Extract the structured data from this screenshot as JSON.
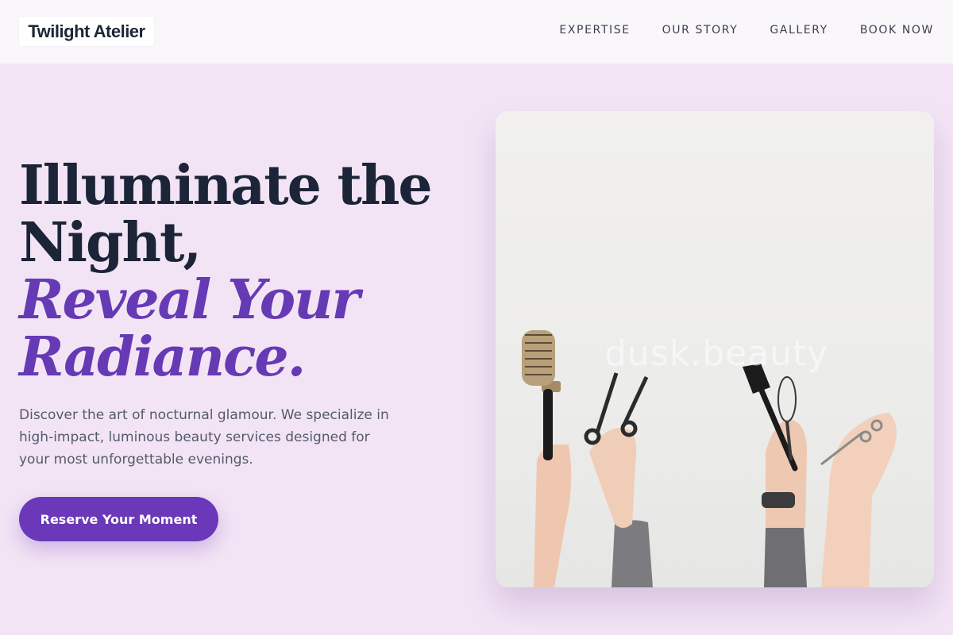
{
  "header": {
    "brand": "Twilight Atelier",
    "nav": [
      {
        "label": "EXPERTISE"
      },
      {
        "label": "OUR STORY"
      },
      {
        "label": "GALLERY"
      },
      {
        "label": "BOOK NOW"
      }
    ]
  },
  "hero": {
    "headline_line1": "Illuminate the",
    "headline_line2": "Night,",
    "headline_accent1": "Reveal Your",
    "headline_accent2": "Radiance.",
    "description": "Discover the art of nocturnal glamour. We specialize in high-impact, luminous beauty services designed for your most unforgettable evenings.",
    "cta_label": "Reserve Your Moment",
    "image_watermark": "dusk.beauty"
  },
  "colors": {
    "background": "#f3e4f5",
    "header": "#faf7fb",
    "heading": "#1c2438",
    "accent": "#6639b5",
    "button": "#6a38b8"
  }
}
